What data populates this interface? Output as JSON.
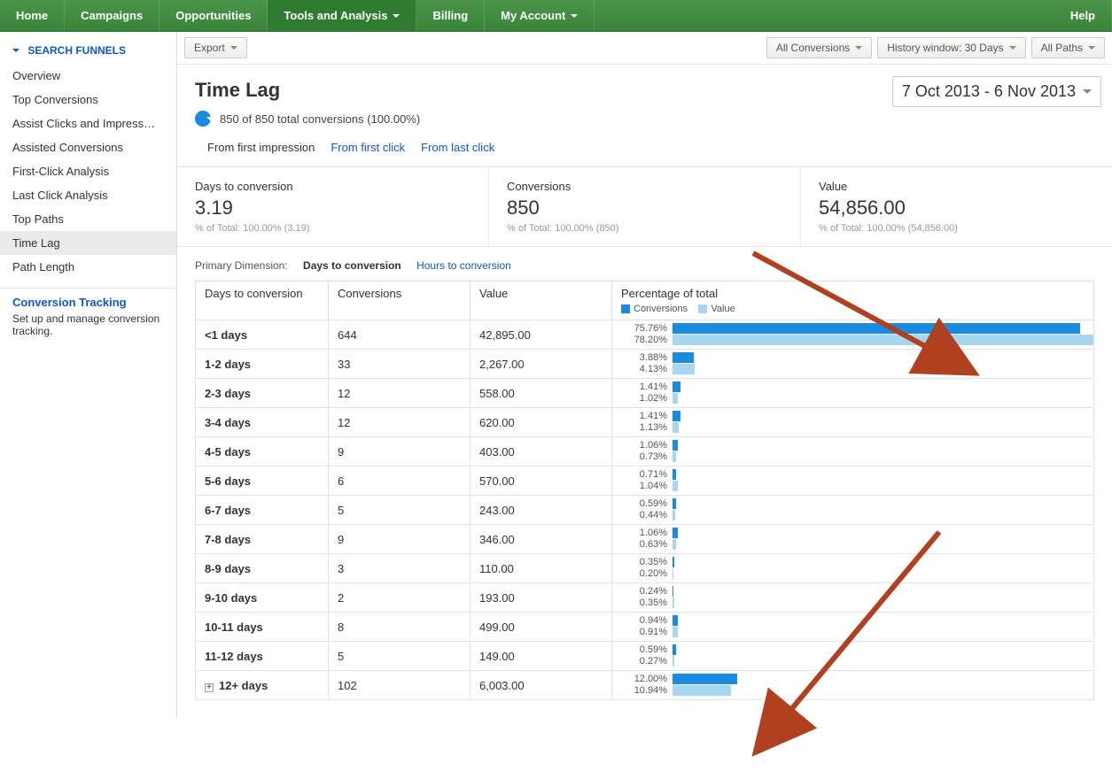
{
  "nav": {
    "items": [
      "Home",
      "Campaigns",
      "Opportunities",
      "Tools and Analysis",
      "Billing",
      "My Account"
    ],
    "dropdown": [
      false,
      false,
      false,
      true,
      false,
      true
    ],
    "activeIndex": 3,
    "help": "Help"
  },
  "sidebar": {
    "header": "SEARCH FUNNELS",
    "items": [
      "Overview",
      "Top Conversions",
      "Assist Clicks and Impress…",
      "Assisted Conversions",
      "First-Click Analysis",
      "Last Click Analysis",
      "Top Paths",
      "Time Lag",
      "Path Length"
    ],
    "selectedIndex": 7,
    "tracking": {
      "title": "Conversion Tracking",
      "desc": "Set up and manage conversion tracking."
    }
  },
  "toolbar": {
    "export": "Export",
    "allConversions": "All Conversions",
    "historyWindow": "History window: 30 Days",
    "allPaths": "All Paths"
  },
  "page": {
    "title": "Time Lag",
    "dateRange": "7 Oct 2013 - 6 Nov 2013",
    "bubble": "850 of 850 total conversions (100.00%)"
  },
  "tabs": {
    "items": [
      "From first impression",
      "From first click",
      "From last click"
    ],
    "activeIndex": 0
  },
  "metrics": [
    {
      "label": "Days to conversion",
      "value": "3.19",
      "sub": "% of Total: 100.00% (3.19)"
    },
    {
      "label": "Conversions",
      "value": "850",
      "sub": "% of Total: 100.00% (850)"
    },
    {
      "label": "Value",
      "value": "54,856.00",
      "sub": "% of Total: 100.00% (54,856.00)"
    }
  ],
  "primaryDimension": {
    "label": "Primary Dimension:",
    "current": "Days to conversion",
    "alt": "Hours to conversion"
  },
  "columns": {
    "days": "Days to conversion",
    "conv": "Conversions",
    "val": "Value",
    "pct": "Percentage of total",
    "legendConv": "Conversions",
    "legendVal": "Value"
  },
  "rows": [
    {
      "days": "<1 days",
      "conv": "644",
      "val": "42,895.00",
      "pctConv": "75.76%",
      "pctVal": "78.20%",
      "wConv": 75.76,
      "wVal": 78.2,
      "expand": false
    },
    {
      "days": "1-2 days",
      "conv": "33",
      "val": "2,267.00",
      "pctConv": "3.88%",
      "pctVal": "4.13%",
      "wConv": 3.88,
      "wVal": 4.13,
      "expand": false
    },
    {
      "days": "2-3 days",
      "conv": "12",
      "val": "558.00",
      "pctConv": "1.41%",
      "pctVal": "1.02%",
      "wConv": 1.41,
      "wVal": 1.02,
      "expand": false
    },
    {
      "days": "3-4 days",
      "conv": "12",
      "val": "620.00",
      "pctConv": "1.41%",
      "pctVal": "1.13%",
      "wConv": 1.41,
      "wVal": 1.13,
      "expand": false
    },
    {
      "days": "4-5 days",
      "conv": "9",
      "val": "403.00",
      "pctConv": "1.06%",
      "pctVal": "0.73%",
      "wConv": 1.06,
      "wVal": 0.73,
      "expand": false
    },
    {
      "days": "5-6 days",
      "conv": "6",
      "val": "570.00",
      "pctConv": "0.71%",
      "pctVal": "1.04%",
      "wConv": 0.71,
      "wVal": 1.04,
      "expand": false
    },
    {
      "days": "6-7 days",
      "conv": "5",
      "val": "243.00",
      "pctConv": "0.59%",
      "pctVal": "0.44%",
      "wConv": 0.59,
      "wVal": 0.44,
      "expand": false
    },
    {
      "days": "7-8 days",
      "conv": "9",
      "val": "346.00",
      "pctConv": "1.06%",
      "pctVal": "0.63%",
      "wConv": 1.06,
      "wVal": 0.63,
      "expand": false
    },
    {
      "days": "8-9 days",
      "conv": "3",
      "val": "110.00",
      "pctConv": "0.35%",
      "pctVal": "0.20%",
      "wConv": 0.35,
      "wVal": 0.2,
      "expand": false
    },
    {
      "days": "9-10 days",
      "conv": "2",
      "val": "193.00",
      "pctConv": "0.24%",
      "pctVal": "0.35%",
      "wConv": 0.24,
      "wVal": 0.35,
      "expand": false
    },
    {
      "days": "10-11 days",
      "conv": "8",
      "val": "499.00",
      "pctConv": "0.94%",
      "pctVal": "0.91%",
      "wConv": 0.94,
      "wVal": 0.91,
      "expand": false
    },
    {
      "days": "11-12 days",
      "conv": "5",
      "val": "149.00",
      "pctConv": "0.59%",
      "pctVal": "0.27%",
      "wConv": 0.59,
      "wVal": 0.27,
      "expand": false
    },
    {
      "days": "12+ days",
      "conv": "102",
      "val": "6,003.00",
      "pctConv": "12.00%",
      "pctVal": "10.94%",
      "wConv": 12.0,
      "wVal": 10.94,
      "expand": true
    }
  ],
  "chart_data": {
    "type": "bar",
    "title": "Time Lag — Percentage of total",
    "categories": [
      "<1 days",
      "1-2 days",
      "2-3 days",
      "3-4 days",
      "4-5 days",
      "5-6 days",
      "6-7 days",
      "7-8 days",
      "8-9 days",
      "9-10 days",
      "10-11 days",
      "11-12 days",
      "12+ days"
    ],
    "series": [
      {
        "name": "Conversions",
        "values": [
          75.76,
          3.88,
          1.41,
          1.41,
          1.06,
          0.71,
          0.59,
          1.06,
          0.35,
          0.24,
          0.94,
          0.59,
          12.0
        ]
      },
      {
        "name": "Value",
        "values": [
          78.2,
          4.13,
          1.02,
          1.13,
          0.73,
          1.04,
          0.44,
          0.63,
          0.2,
          0.35,
          0.91,
          0.27,
          10.94
        ]
      }
    ],
    "xlabel": "Days to conversion",
    "ylabel": "Percentage of total",
    "ylim": [
      0,
      100
    ]
  }
}
